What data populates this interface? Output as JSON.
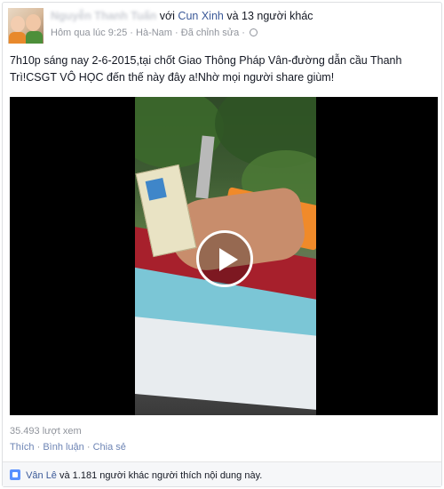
{
  "post": {
    "author": "Nguyễn Thanh Tuấn",
    "with_prefix": "với",
    "tagged_name": "Cun Xinh",
    "and_others": "và 13 người khác",
    "time": "Hôm qua lúc 9:25",
    "location": "Hà-Nam",
    "edited": "Đã chỉnh sửa",
    "separator": "·",
    "privacy_icon": "globe-icon",
    "text": "7h10p sáng nay 2-6-2015,tại chốt Giao Thông Pháp Vân-đường dẫn cầu Thanh Trì!CSGT VÔ HỌC đến thế này đây a!Nhờ mọi người share giùm!",
    "video_icon": "play-icon"
  },
  "stats": {
    "views": "35.493 lượt xem"
  },
  "actions": {
    "like": "Thích",
    "comment": "Bình luận",
    "share": "Chia sẻ",
    "sep": "·"
  },
  "likes": {
    "icon": "like-icon",
    "liker": "Vân Lê",
    "rest": "và 1.181 người khác người thích nội dung này."
  },
  "colors": {
    "link": "#3b5998",
    "muted": "#90949c",
    "like_blue": "#5890ff"
  }
}
